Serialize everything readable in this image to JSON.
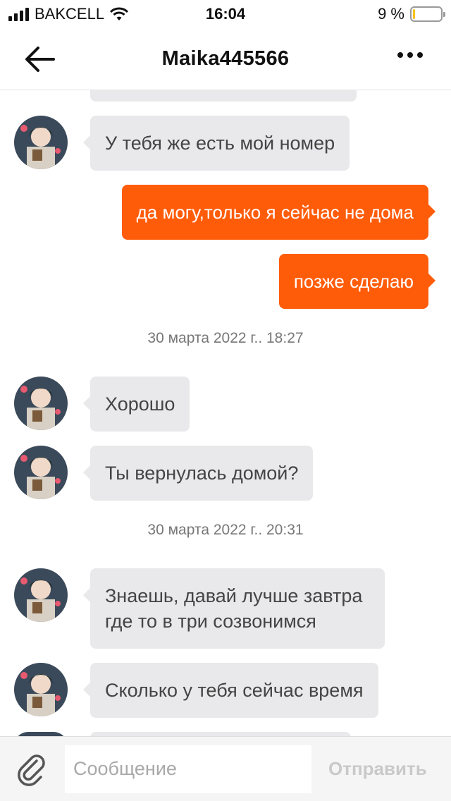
{
  "status_bar": {
    "carrier": "BAKCELL",
    "time": "16:04",
    "battery_percent": "9 %",
    "battery_level": 0.09,
    "battery_color": "#f7c31a"
  },
  "header": {
    "title": "Maika445566",
    "back_icon": "arrow-left-icon",
    "more_icon": "more-horizontal-icon"
  },
  "messages": [
    {
      "side": "incoming",
      "text": "У тебя же есть мой номер"
    },
    {
      "side": "outgoing",
      "text": "да могу,только я сейчас не дома"
    },
    {
      "side": "outgoing",
      "text": "позже сделаю"
    },
    {
      "side": "date",
      "text": "30 марта 2022 г.. 18:27"
    },
    {
      "side": "incoming",
      "text": "Хорошо"
    },
    {
      "side": "incoming",
      "text": "Ты вернулась домой?"
    },
    {
      "side": "date",
      "text": "30 марта 2022 г.. 20:31"
    },
    {
      "side": "incoming",
      "text": "Знаешь, давай лучше завтра где то в три созвонимся"
    },
    {
      "side": "incoming",
      "text": "Сколько у тебя сейчас время"
    }
  ],
  "input_bar": {
    "attach_icon": "paperclip-icon",
    "placeholder": "Сообщение",
    "send_label": "Отправить"
  },
  "colors": {
    "outgoing_bubble": "#ff5c0a",
    "incoming_bubble": "#e9e8ea",
    "send_disabled": "#c9c9c9"
  }
}
